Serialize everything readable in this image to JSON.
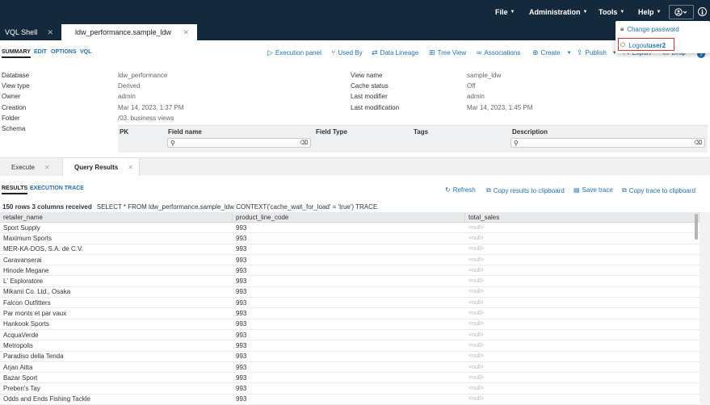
{
  "topbar": {
    "menus": [
      {
        "label": "File"
      },
      {
        "label": "Administration"
      },
      {
        "label": "Tools"
      },
      {
        "label": "Help"
      }
    ]
  },
  "tabs": {
    "vql_shell": "VQL Shell",
    "active": "ldw_performance.sample_ldw"
  },
  "user_menu": {
    "change_password": "Change password",
    "logout_prefix": "Logout ",
    "logout_user": "user2"
  },
  "subnav": {
    "tabs": [
      "SUMMARY",
      "EDIT",
      "OPTIONS",
      "VQL"
    ],
    "actions": [
      "Execution panel",
      "Used By",
      "Data Lineage",
      "Tree View",
      "Associations",
      "Create",
      "Publish",
      "Export",
      "Drop"
    ]
  },
  "summary": {
    "left": [
      {
        "label": "Database",
        "value": "ldw_performance"
      },
      {
        "label": "View type",
        "value": "Derived"
      },
      {
        "label": "Owner",
        "value": "admin"
      },
      {
        "label": "Creation",
        "value": "Mar 14, 2023, 1:37 PM"
      },
      {
        "label": "Folder",
        "value": "/03. business views"
      },
      {
        "label": "Schema",
        "value": ""
      }
    ],
    "right": [
      {
        "label": "View name",
        "value": "sample_ldw"
      },
      {
        "label": "Cache status",
        "value": "Off"
      },
      {
        "label": "Last modifier",
        "value": "admin"
      },
      {
        "label": "Last modification",
        "value": "Mar 14, 2023, 1:45 PM"
      }
    ]
  },
  "schema_table": {
    "columns": [
      "PK",
      "Field name",
      "Field Type",
      "Tags",
      "Description"
    ]
  },
  "panel": {
    "tabs": [
      "Execute",
      "Query Results"
    ]
  },
  "results": {
    "tabs": [
      "RESULTS",
      "EXECUTION TRACE"
    ],
    "actions": [
      "Refresh",
      "Copy results to clipboard",
      "Save trace",
      "Copy trace to clipboard"
    ],
    "count_text": "150 rows 3 columns received",
    "query": "SELECT * FROM ldw_performance.sample_ldw CONTEXT('cache_wait_for_load' = 'true') TRACE",
    "columns": [
      "retailer_name",
      "product_line_code",
      "total_sales"
    ],
    "rows": [
      [
        "Sport Supply",
        "993",
        "<null>"
      ],
      [
        "Maximum Sports",
        "993",
        "<null>"
      ],
      [
        "MER-KA-DOS, S.A. de C.V.",
        "993",
        "<null>"
      ],
      [
        "Caravanserai",
        "993",
        "<null>"
      ],
      [
        "Hinode Megane",
        "993",
        "<null>"
      ],
      [
        "L' Esploratore",
        "993",
        "<null>"
      ],
      [
        "Mikami Co. Ltd., Osaka",
        "993",
        "<null>"
      ],
      [
        "Falcon Outfitters",
        "993",
        "<null>"
      ],
      [
        "Par monts et par vaux",
        "993",
        "<null>"
      ],
      [
        "Hankook Sports",
        "993",
        "<null>"
      ],
      [
        "AcquaVerde",
        "993",
        "<null>"
      ],
      [
        "Metropolis",
        "993",
        "<null>"
      ],
      [
        "Paradiso della Tenda",
        "993",
        "<null>"
      ],
      [
        "Arjan Aitta",
        "993",
        "<null>"
      ],
      [
        "Bazar Sport",
        "993",
        "<null>"
      ],
      [
        "Preben's Tay",
        "993",
        "<null>"
      ],
      [
        "Odds and Ends Fishing Tackle",
        "993",
        "<null>"
      ]
    ]
  }
}
